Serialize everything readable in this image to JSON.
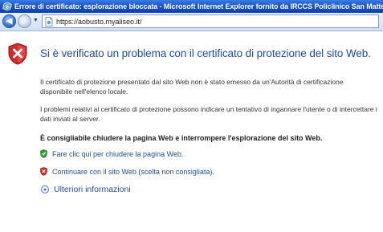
{
  "window": {
    "title": "Errore di certificato: esplorazione bloccata - Microsoft Internet Explorer fornito da IRCCS Policlinico San Matteo"
  },
  "navbar": {
    "back_label": "◀",
    "forward_label": "▶",
    "dropdown_label": "▼",
    "url": "https://aobusto.myaliseo.it/"
  },
  "content": {
    "headline": "Si è verificato un problema con il certificato di protezione del sito Web.",
    "paragraph1": "Il certificato di protezione presentato dal sito Web non è stato emesso da un'Autorità di certificazione disponibile nell'elenco locale.",
    "paragraph2": "I problemi relativi al certificato di protezione possono indicare un tentativo di ingannare l'utente o di intercettare i dati inviati al server.",
    "recommendation": "È consigliabile chiudere la pagina Web e interrompere l'esplorazione del sito Web.",
    "close_link": "Fare clic qui per chiudere la pagina Web.",
    "continue_link": "Continuare con il sito Web (scelta non consigliata).",
    "more_info": "Ulteriori informazioni"
  },
  "icons": {
    "title_icon": "ie-logo-icon",
    "page_icon": "page-icon",
    "error_shield": "error-shield-icon",
    "close_shield": "green-check-shield-icon",
    "continue_shield": "red-x-shield-icon",
    "more_info": "expand-circle-icon"
  },
  "colors": {
    "titlebar": "#1a55c9",
    "headline": "#1f4e9c",
    "link": "#1f4e9c",
    "error_red": "#d12b2b",
    "safe_green": "#3a9a3a"
  }
}
